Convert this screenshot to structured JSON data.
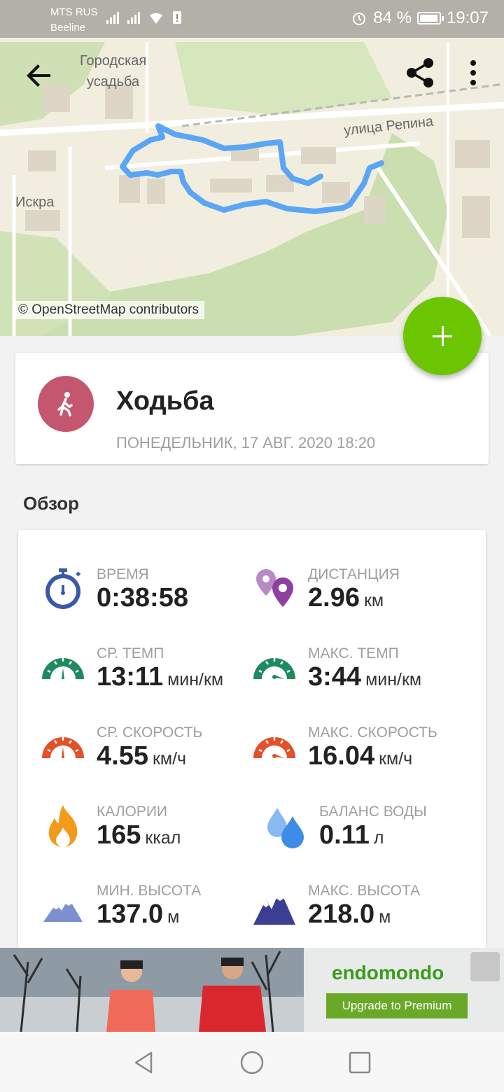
{
  "status_bar": {
    "carrier_1": "MTS RUS",
    "carrier_2": "Beeline",
    "battery": "84 %",
    "time": "19:07"
  },
  "map": {
    "label_estate_1": "Городская",
    "label_estate_2": "усадьба",
    "label_street": "улица Репина",
    "label_district": "Искра",
    "credit": "© OpenStreetMap contributors",
    "route_color": "#5aa6f5"
  },
  "activity": {
    "sport": "Ходьба",
    "date": "ПОНЕДЕЛЬНИК, 17 АВГ. 2020 18:20",
    "avatar_color": "#c4566f"
  },
  "overview": {
    "title": "Обзор",
    "stats": {
      "time": {
        "label": "ВРЕМЯ",
        "value": "0:38:58",
        "unit": ""
      },
      "distance": {
        "label": "ДИСТАНЦИЯ",
        "value": "2.96",
        "unit": "км"
      },
      "avg_pace": {
        "label": "СР. ТЕМП",
        "value": "13:11",
        "unit": "мин/км"
      },
      "max_pace": {
        "label": "МАКС. ТЕМП",
        "value": "3:44",
        "unit": "мин/км"
      },
      "avg_speed": {
        "label": "СР. СКОРОСТЬ",
        "value": "4.55",
        "unit": "км/ч"
      },
      "max_speed": {
        "label": "МАКС. СКОРОСТЬ",
        "value": "16.04",
        "unit": "км/ч"
      },
      "calories": {
        "label": "КАЛОРИИ",
        "value": "165",
        "unit": "ккал"
      },
      "water": {
        "label": "БАЛАНС ВОДЫ",
        "value": "0.11",
        "unit": "л"
      },
      "min_altitude": {
        "label": "МИН. ВЫСОТА",
        "value": "137.0",
        "unit": "м"
      },
      "max_altitude": {
        "label": "МАКС. ВЫСОТА",
        "value": "218.0",
        "unit": "м"
      }
    }
  },
  "ad": {
    "brand": "endomondo",
    "button": "Upgrade to Premium"
  },
  "colors": {
    "fab": "#6bc500",
    "blue": "#3a5aa8",
    "purple": "#8e3fa0",
    "green": "#1f8a5e",
    "orange_red": "#e2512a",
    "flame": "#f39a1a",
    "water": "#3d8de8"
  }
}
